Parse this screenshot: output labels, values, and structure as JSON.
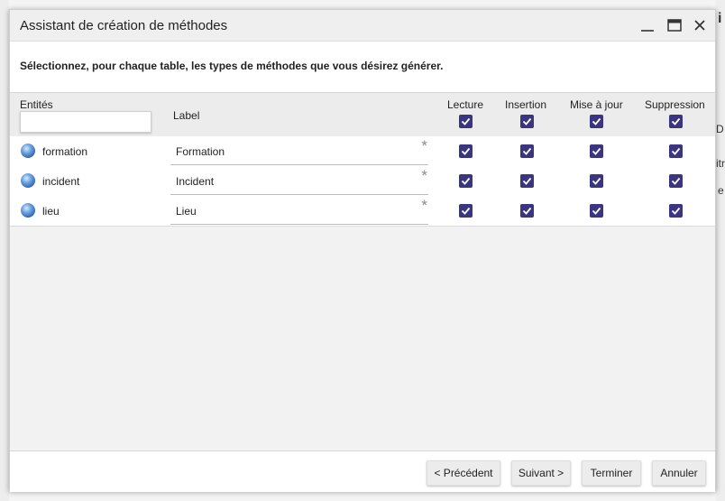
{
  "background": {
    "fragments": [
      "D",
      "itr",
      "e",
      "i"
    ]
  },
  "dialog": {
    "title": "Assistant de création de méthodes",
    "controls": {
      "minimize_icon": "minimize-icon",
      "maximize_icon": "maximize-icon",
      "close_icon": "close-icon"
    },
    "instruction": "Sélectionnez, pour chaque table, les types de méthodes que vous désirez générer.",
    "grid": {
      "columns": {
        "entities": "Entités",
        "label": "Label",
        "read": "Lecture",
        "insert": "Insertion",
        "update": "Mise à jour",
        "delete": "Suppression"
      },
      "filter_value": "",
      "header_checks": {
        "read": true,
        "insert": true,
        "update": true,
        "delete": true
      },
      "rows": [
        {
          "entity": "formation",
          "label": "Formation",
          "required_mark": "*",
          "read": true,
          "insert": true,
          "update": true,
          "delete": true
        },
        {
          "entity": "incident",
          "label": "Incident",
          "required_mark": "*",
          "read": true,
          "insert": true,
          "update": true,
          "delete": true
        },
        {
          "entity": "lieu",
          "label": "Lieu",
          "required_mark": "*",
          "read": true,
          "insert": true,
          "update": true,
          "delete": true
        }
      ]
    },
    "buttons": {
      "previous": "< Précédent",
      "next": "Suivant >",
      "finish": "Terminer",
      "cancel": "Annuler"
    },
    "colors": {
      "checkbox": "#3b3580",
      "header_bg": "#ececec",
      "titlebar_bg": "#efefef"
    }
  }
}
